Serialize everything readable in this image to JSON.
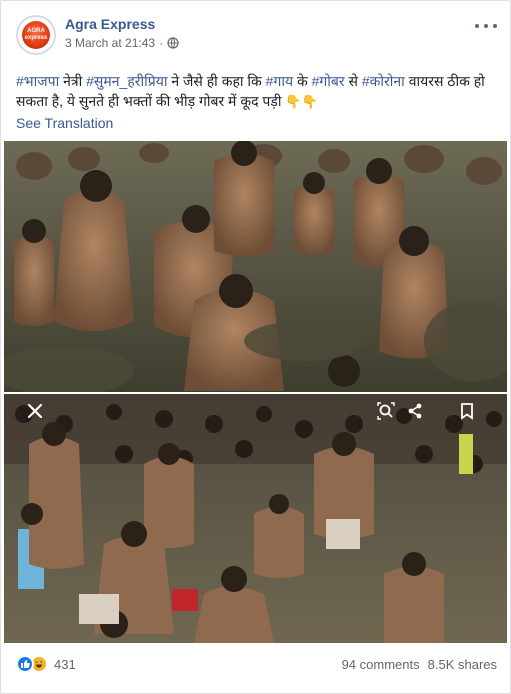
{
  "post": {
    "page_name": "Agra Express",
    "avatar_text_top": "AGRA",
    "avatar_text_bottom": "express",
    "timestamp": "3 March at 21:43",
    "privacy_icon": "globe-icon",
    "body_segments": [
      {
        "text": "#भाजपा",
        "tag": true
      },
      {
        "text": " नेत्री ",
        "tag": false
      },
      {
        "text": "#सुमन_हरीप्रिया",
        "tag": true
      },
      {
        "text": " ने जैसे ही कहा कि ",
        "tag": false
      },
      {
        "text": "#गाय",
        "tag": true
      },
      {
        "text": " के ",
        "tag": false
      },
      {
        "text": "#गोबर",
        "tag": true
      },
      {
        "text": " से ",
        "tag": false
      },
      {
        "text": "#कोरोना",
        "tag": true
      },
      {
        "text": " वायरस ठीक हो सकता है, ये सुनते ही भक्तों की भीड़ गोबर में कूद पड़ी ",
        "tag": false
      }
    ],
    "body_emoji": "👇👇",
    "see_translation": "See Translation"
  },
  "photos": {
    "top": "crowd-in-dung-photo",
    "bottom": "crowd-in-dung-photo-screenshot",
    "overlay_icons": [
      "close-icon",
      "camera-search-icon",
      "share-icon",
      "bookmark-icon"
    ]
  },
  "footer": {
    "reactions": [
      "like-icon",
      "haha-icon"
    ],
    "reaction_count": "431",
    "comments": "94 comments",
    "shares": "8.5K shares"
  },
  "colors": {
    "link": "#385898",
    "like": "#1877f2",
    "haha": "#f7b125"
  }
}
